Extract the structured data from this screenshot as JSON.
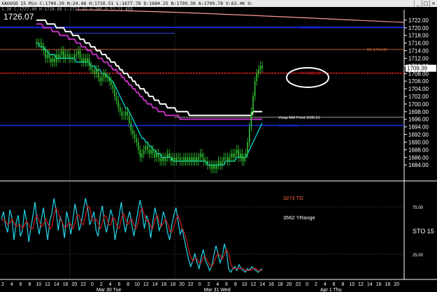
{
  "window": {
    "title": "XAUUSD 15 Min  C:1709.39  N:24.48  H:1710.51  L:1677.78  D:1684.25  B:1709.39  A:1709.78  V:63.4K  O:",
    "subtitle": "1.30  C:1727.40  H:1728.68  L:1727.32  V:76E  0:52:21  459",
    "controls": [
      "_",
      "□",
      "×"
    ]
  },
  "last_price_display": "1726.07",
  "colors": {
    "background": "#000000",
    "candles": "#32cd32",
    "ema_fast": "#00cccc",
    "ema_mid": "#cc33cc",
    "ema_slow": "#ffffff",
    "long_ma": "#ff9999",
    "r1_line": "#1a2bd9",
    "r2_line": "#d86a3a",
    "pivot_line": "#d61b1b",
    "s1_line": "#1a2bd9",
    "stoch_k": "#22d8ee",
    "stoch_d": "#d01a1a",
    "callout": "#ffffff",
    "td_text": "#ff6a3a"
  },
  "chart_data": [
    {
      "type": "candlestick",
      "title": "XAUUSD 15 Min",
      "ylim": [
        1680,
        1724
      ],
      "y_ticks": [
        "1722.00",
        "1720.00",
        "1718.00",
        "1716.00",
        "1714.00",
        "1712.00",
        "1710.00",
        "1708.00",
        "1706.00",
        "1704.00",
        "1702.00",
        "1700.00",
        "1698.00",
        "1696.00",
        "1694.00",
        "1692.00",
        "1690.00",
        "1688.00",
        "1686.00",
        "1684.00"
      ],
      "x_ticks": [
        "2",
        "4",
        "6",
        "8",
        "10",
        "12",
        "14",
        "16",
        "20",
        "22",
        "0",
        "2",
        "4",
        "6",
        "8",
        "10",
        "12",
        "14",
        "16",
        "18",
        "20",
        "22",
        "0",
        "2",
        "4",
        "6",
        "8",
        "10",
        "12",
        "14",
        "16",
        "18",
        "20",
        "22",
        "0",
        "2",
        "4",
        "6",
        "8",
        "10",
        "12",
        "14",
        "16",
        "18",
        "20"
      ],
      "date_labels": [
        {
          "label": "Mar 30 Tue",
          "tick_index": 10
        },
        {
          "label": "Mar 31 Wed",
          "tick_index": 22
        },
        {
          "label": "Apr 1 Thu",
          "tick_index": 35
        }
      ],
      "close_series": [
        1716,
        1716,
        1716,
        1715,
        1714,
        1712,
        1713,
        1712,
        1711,
        1712,
        1711,
        1713,
        1712,
        1713,
        1714,
        1712,
        1713,
        1713,
        1712,
        1712,
        1712,
        1713,
        1713,
        1714,
        1712,
        1711,
        1712,
        1711,
        1712,
        1710,
        1709,
        1709,
        1708,
        1709,
        1707,
        1706,
        1707,
        1708,
        1707,
        1707,
        1706,
        1705,
        1704,
        1702,
        1701,
        1699,
        1698,
        1697,
        1697,
        1698,
        1697,
        1695,
        1693,
        1692,
        1691,
        1690,
        1688,
        1686,
        1687,
        1688,
        1689,
        1688,
        1687,
        1688,
        1687,
        1686,
        1687,
        1686,
        1685,
        1686,
        1685,
        1686,
        1687,
        1686,
        1685,
        1686,
        1685,
        1686,
        1686,
        1685,
        1685,
        1686,
        1685,
        1686,
        1685,
        1686,
        1685,
        1686,
        1685,
        1686,
        1687,
        1686,
        1685,
        1685,
        1684,
        1684,
        1683,
        1684,
        1683,
        1684,
        1685,
        1684,
        1685,
        1686,
        1686,
        1685,
        1686,
        1687,
        1686,
        1687,
        1688,
        1686,
        1687,
        1685,
        1686,
        1687,
        1690,
        1694,
        1698,
        1702,
        1706,
        1708,
        1709,
        1710,
        1709.39
      ],
      "ema_fast": [
        1716,
        1716,
        1715,
        1715,
        1715,
        1714,
        1714,
        1713,
        1713,
        1713,
        1713,
        1712,
        1712,
        1712,
        1712,
        1712,
        1712,
        1712,
        1712,
        1712,
        1712,
        1712,
        1711,
        1711,
        1711,
        1711,
        1711,
        1711,
        1711,
        1711,
        1710,
        1710,
        1710,
        1709,
        1709,
        1709,
        1708,
        1708,
        1708,
        1707,
        1707,
        1706,
        1706,
        1705,
        1704,
        1703,
        1702,
        1701,
        1700,
        1699,
        1699,
        1698,
        1697,
        1696,
        1695,
        1694,
        1693,
        1692,
        1691,
        1691,
        1690,
        1690,
        1689,
        1689,
        1688,
        1688,
        1687,
        1687,
        1687,
        1686,
        1686,
        1686,
        1686,
        1686,
        1686,
        1685,
        1685,
        1685,
        1685,
        1685,
        1685,
        1685,
        1685,
        1685,
        1685,
        1685,
        1685,
        1685,
        1685,
        1685,
        1685,
        1685,
        1685,
        1685,
        1684,
        1684,
        1684,
        1684,
        1684,
        1684,
        1684,
        1684,
        1684,
        1684,
        1685,
        1685,
        1685,
        1685,
        1685,
        1685,
        1686,
        1686,
        1686,
        1686,
        1686,
        1686,
        1687,
        1688,
        1689,
        1690,
        1691,
        1692,
        1693,
        1694,
        1695
      ],
      "ema_mid": [
        1721,
        1721,
        1721,
        1721,
        1720,
        1720,
        1720,
        1720,
        1720,
        1719,
        1719,
        1719,
        1719,
        1718,
        1718,
        1718,
        1718,
        1718,
        1717,
        1717,
        1717,
        1717,
        1716,
        1716,
        1716,
        1715,
        1715,
        1715,
        1714,
        1714,
        1714,
        1713,
        1713,
        1713,
        1712,
        1712,
        1712,
        1711,
        1711,
        1711,
        1710,
        1710,
        1709,
        1709,
        1709,
        1708,
        1708,
        1707,
        1707,
        1706,
        1706,
        1705,
        1705,
        1704,
        1704,
        1703,
        1703,
        1702,
        1702,
        1701,
        1701,
        1700,
        1700,
        1700,
        1699,
        1699,
        1699,
        1698,
        1698,
        1698,
        1698,
        1697,
        1697,
        1697,
        1697,
        1697,
        1697,
        1697,
        1697,
        1696,
        1696,
        1696,
        1696,
        1696,
        1696,
        1696,
        1696,
        1696,
        1696,
        1696,
        1696,
        1696,
        1696,
        1696,
        1696,
        1696,
        1696,
        1696,
        1696,
        1696,
        1696,
        1696,
        1696,
        1696,
        1696,
        1696,
        1696,
        1696,
        1696,
        1696,
        1696,
        1696,
        1696,
        1696,
        1696,
        1696,
        1696,
        1696,
        1696,
        1696,
        1696,
        1696,
        1696,
        1696,
        1696
      ],
      "ema_slow": [
        1722,
        1722,
        1722,
        1722,
        1722,
        1722,
        1721,
        1721,
        1721,
        1721,
        1721,
        1720,
        1720,
        1720,
        1720,
        1720,
        1719,
        1719,
        1719,
        1719,
        1718,
        1718,
        1718,
        1718,
        1717,
        1717,
        1717,
        1716,
        1716,
        1716,
        1715,
        1715,
        1715,
        1714,
        1714,
        1714,
        1713,
        1713,
        1713,
        1712,
        1712,
        1711,
        1711,
        1711,
        1710,
        1710,
        1709,
        1709,
        1708,
        1708,
        1708,
        1707,
        1707,
        1706,
        1706,
        1705,
        1705,
        1704,
        1704,
        1704,
        1703,
        1703,
        1702,
        1702,
        1702,
        1701,
        1701,
        1701,
        1700,
        1700,
        1700,
        1700,
        1699,
        1699,
        1699,
        1699,
        1699,
        1698,
        1698,
        1698,
        1698,
        1698,
        1698,
        1698,
        1697,
        1697,
        1697,
        1697,
        1697,
        1697,
        1697,
        1697,
        1697,
        1697,
        1697,
        1697,
        1697,
        1697,
        1697,
        1697,
        1697,
        1697,
        1697,
        1697,
        1697,
        1697,
        1697,
        1697,
        1697,
        1697,
        1697,
        1697,
        1697,
        1697,
        1697,
        1697,
        1697,
        1697,
        1697,
        1698,
        1698,
        1698,
        1698,
        1698,
        1698
      ],
      "levels": [
        {
          "name": "R1",
          "label": "R1  1720.11",
          "value": 1720.11
        },
        {
          "name": "R2",
          "label": "R2  1714.32",
          "value": 1714.32
        },
        {
          "name": "Pivot",
          "label": "PP  1708.10",
          "value": 1708.1
        },
        {
          "name": "Vwap Mid Point",
          "label": "Vwap Mid Point  1696.51",
          "value": 1696.51
        },
        {
          "name": "S1",
          "label": "S1  1694.38",
          "value": 1694.38
        }
      ],
      "current_price_label": "1709.39"
    },
    {
      "type": "line",
      "title": "STO",
      "ylim": [
        0,
        100
      ],
      "y_ticks": [
        "25.00",
        "75.00"
      ],
      "side_label": "STO  15",
      "annotations": [
        "3273 TD",
        "3562 YRange"
      ],
      "series": [
        {
          "name": "%K",
          "values": [
            62,
            70,
            55,
            48,
            72,
            64,
            40,
            58,
            66,
            44,
            50,
            72,
            60,
            38,
            52,
            66,
            80,
            58,
            46,
            62,
            74,
            56,
            40,
            60,
            68,
            84,
            72,
            50,
            64,
            58,
            42,
            70,
            60,
            46,
            62,
            78,
            66,
            50,
            58,
            72,
            84,
            74,
            56,
            62,
            70,
            50,
            44,
            66,
            76,
            58,
            48,
            60,
            72,
            64,
            40,
            52,
            66,
            80,
            60,
            48,
            62,
            70,
            56,
            44,
            58,
            72,
            82,
            68,
            52,
            66,
            58,
            42,
            60,
            74,
            64,
            50,
            56,
            70,
            62,
            48,
            40,
            56,
            66,
            74,
            60,
            46,
            52,
            40,
            30,
            20,
            12,
            18,
            26,
            16,
            10,
            22,
            30,
            18,
            14,
            8,
            12,
            24,
            34,
            26,
            16,
            22,
            36,
            28,
            10,
            6,
            10,
            12,
            8,
            14,
            10,
            8,
            6,
            10,
            8,
            12,
            10,
            8,
            6,
            8,
            10
          ]
        },
        {
          "name": "%D",
          "values": [
            60,
            62,
            60,
            56,
            58,
            62,
            58,
            54,
            56,
            56,
            52,
            56,
            60,
            56,
            52,
            52,
            62,
            66,
            60,
            54,
            56,
            62,
            58,
            52,
            54,
            66,
            74,
            70,
            62,
            58,
            54,
            54,
            58,
            56,
            52,
            58,
            66,
            66,
            58,
            56,
            66,
            76,
            74,
            62,
            60,
            62,
            58,
            52,
            58,
            66,
            64,
            56,
            56,
            64,
            62,
            54,
            52,
            62,
            68,
            62,
            56,
            60,
            62,
            56,
            52,
            58,
            70,
            74,
            66,
            60,
            60,
            54,
            52,
            62,
            66,
            60,
            54,
            58,
            62,
            58,
            50,
            48,
            54,
            62,
            66,
            60,
            52,
            48,
            40,
            30,
            22,
            18,
            20,
            20,
            16,
            16,
            22,
            22,
            18,
            14,
            12,
            16,
            22,
            26,
            24,
            20,
            24,
            30,
            26,
            16,
            10,
            10,
            10,
            10,
            10,
            10,
            8,
            8,
            8,
            9,
            10,
            10,
            8,
            8,
            8
          ]
        }
      ]
    }
  ]
}
